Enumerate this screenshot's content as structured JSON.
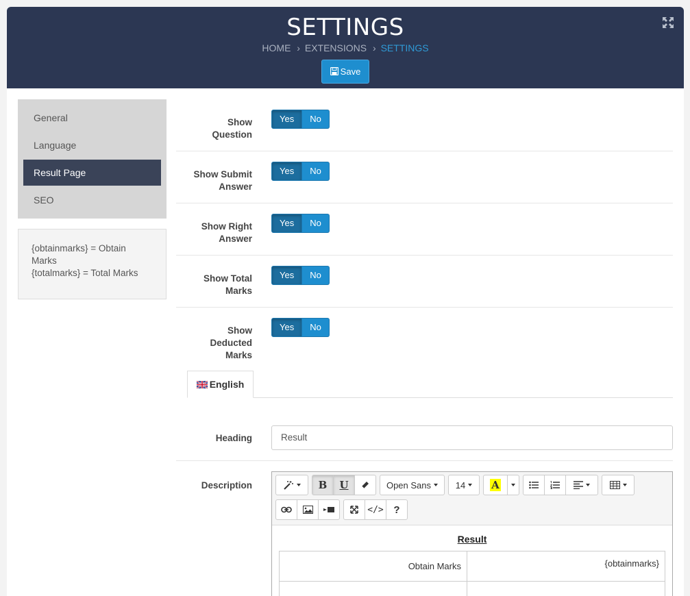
{
  "header": {
    "title": "SETTINGS",
    "breadcrumb": [
      "HOME",
      "EXTENSIONS",
      "SETTINGS"
    ],
    "breadcrumb_sep": "›",
    "save_label": "Save"
  },
  "sidebar": {
    "items": [
      {
        "label": "General"
      },
      {
        "label": "Language"
      },
      {
        "label": "Result Page"
      },
      {
        "label": "SEO"
      }
    ],
    "active_index": 2,
    "note_lines": [
      "{obtainmarks} = Obtain Marks",
      "{totalmarks} = Total Marks"
    ]
  },
  "toggles": [
    {
      "label_lines": [
        "Show",
        "Question"
      ],
      "yes": "Yes",
      "no": "No",
      "value": "Yes"
    },
    {
      "label_lines": [
        "Show Submit",
        "Answer"
      ],
      "yes": "Yes",
      "no": "No",
      "value": "Yes"
    },
    {
      "label_lines": [
        "Show Right",
        "Answer"
      ],
      "yes": "Yes",
      "no": "No",
      "value": "Yes"
    },
    {
      "label_lines": [
        "Show Total",
        "Marks"
      ],
      "yes": "Yes",
      "no": "No",
      "value": "Yes"
    },
    {
      "label_lines": [
        "Show",
        "Deducted",
        "Marks"
      ],
      "yes": "Yes",
      "no": "No",
      "value": "Yes"
    }
  ],
  "language_tab": {
    "label": "English"
  },
  "heading": {
    "label": "Heading",
    "value": "Result"
  },
  "description": {
    "label": "Description",
    "toolbar": {
      "font_family": "Open Sans",
      "font_size": "14",
      "bold": "B",
      "underline": "U",
      "highlight": "A",
      "help": "?",
      "code": "</>"
    },
    "content_title": "Result",
    "table_rows": [
      {
        "label": "Obtain Marks",
        "value": "{obtainmarks}"
      },
      {
        "label": "",
        "value": ""
      }
    ]
  },
  "colors": {
    "header_bg": "#2c3753",
    "accent": "#1e8ecf",
    "active_menu": "#3a4358"
  }
}
